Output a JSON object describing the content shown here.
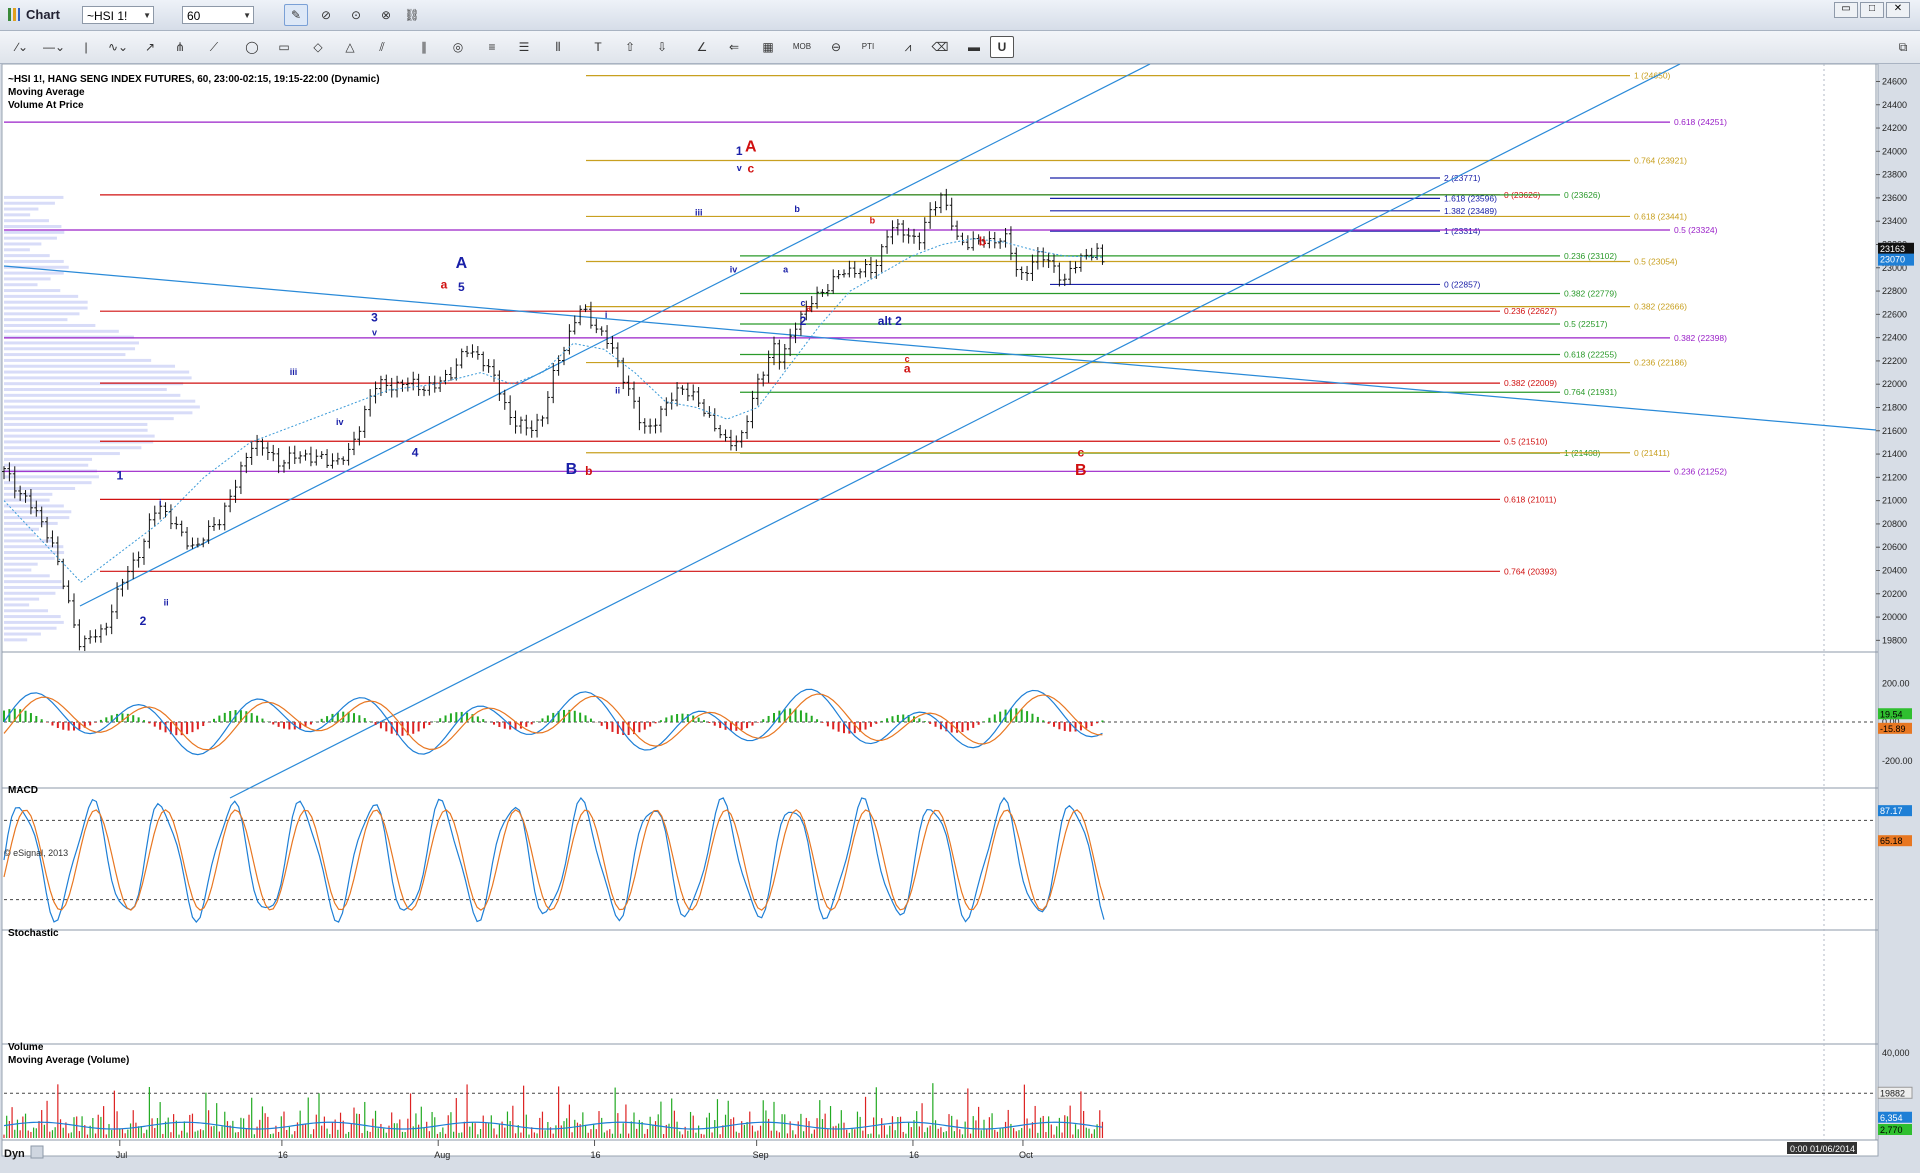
{
  "app": {
    "title": "Chart"
  },
  "toolbar": {
    "symbol": "~HSI 1!",
    "interval": "60"
  },
  "window_buttons": [
    "▭",
    "□",
    "✕"
  ],
  "icons": [
    "pencil-icon",
    "cursor-icon",
    "play-icon",
    "link-icon",
    "line-tool-icon",
    "horizontal-line-icon",
    "vertical-line-icon",
    "zigzag-icon",
    "arrow-icon",
    "fork-icon",
    "ellipse-icon",
    "rectangle-icon",
    "triangle-icon",
    "channel-icon",
    "fibonacci-icon",
    "text-icon",
    "up-arrow-icon",
    "down-arrow-icon",
    "gann-icon",
    "table-icon",
    "mob-icon",
    "pti-icon",
    "lock-icon"
  ],
  "toolbar_labels": {
    "mob": "MOB",
    "pti": "PTI"
  },
  "header": {
    "line1": "~HSI 1!, HANG SENG INDEX FUTURES, 60, 23:00-02:15, 19:15-22:00 (Dynamic)",
    "line2": "Moving Average",
    "line3": "Volume At Price"
  },
  "watermark": "© eSignal, 2013",
  "status": {
    "left": "Dyn",
    "right": "0:00 01/06/2014"
  },
  "colors": {
    "up_bar": "#22aa22",
    "down_bar": "#dd2222",
    "macd_fast": "#1e7fd6",
    "macd_slow": "#e87722",
    "channel": "#2a8ad8",
    "red": "#d01010",
    "gold": "#c8a020",
    "green": "#2a9a2a",
    "purple": "#9a20c8",
    "navy": "#1a20a8"
  },
  "chart_data": [
    {
      "type": "line",
      "title": "~HSI 1!, HANG SENG INDEX FUTURES, 60",
      "x_ticks": [
        "Jul",
        "16",
        "Aug",
        "16",
        "Sep",
        "16",
        "Oct"
      ],
      "ylim": [
        19700,
        24750
      ],
      "y_ticks": [
        19800,
        20000,
        20200,
        20400,
        20600,
        20800,
        21000,
        21200,
        21400,
        21600,
        21800,
        22000,
        22200,
        22400,
        22600,
        22800,
        23000,
        23200,
        23400,
        23600,
        23800,
        24000,
        24200,
        24400,
        24600
      ],
      "price_path": [
        [
          0,
          21250
        ],
        [
          3,
          21000
        ],
        [
          6,
          20700
        ],
        [
          8,
          20200
        ],
        [
          10,
          19750
        ],
        [
          13,
          19900
        ],
        [
          16,
          20400
        ],
        [
          18,
          20600
        ],
        [
          20,
          21000
        ],
        [
          23,
          20700
        ],
        [
          25,
          20600
        ],
        [
          28,
          20850
        ],
        [
          30,
          21100
        ],
        [
          32,
          21500
        ],
        [
          34,
          21430
        ],
        [
          36,
          21330
        ],
        [
          39,
          21400
        ],
        [
          42,
          21330
        ],
        [
          45,
          21400
        ],
        [
          47,
          21800
        ],
        [
          48,
          21970
        ],
        [
          50,
          22000
        ],
        [
          53,
          22000
        ],
        [
          56,
          21970
        ],
        [
          58,
          22100
        ],
        [
          60,
          22280
        ],
        [
          62,
          22250
        ],
        [
          64,
          22000
        ],
        [
          66,
          21700
        ],
        [
          68,
          21600
        ],
        [
          70,
          21730
        ],
        [
          72,
          22200
        ],
        [
          74,
          22520
        ],
        [
          75,
          22640
        ],
        [
          77,
          22500
        ],
        [
          79,
          22300
        ],
        [
          81,
          22000
        ],
        [
          83,
          21600
        ],
        [
          84,
          21650
        ],
        [
          86,
          21800
        ],
        [
          88,
          22000
        ],
        [
          90,
          21850
        ],
        [
          92,
          21700
        ],
        [
          94,
          21460
        ],
        [
          96,
          21580
        ],
        [
          98,
          22000
        ],
        [
          100,
          22350
        ],
        [
          101,
          22170
        ],
        [
          103,
          22550
        ],
        [
          105,
          22700
        ],
        [
          107,
          22850
        ],
        [
          109,
          22950
        ],
        [
          111,
          23000
        ],
        [
          113,
          22950
        ],
        [
          115,
          23350
        ],
        [
          117,
          23300
        ],
        [
          119,
          23250
        ],
        [
          121,
          23550
        ],
        [
          122,
          23650
        ],
        [
          123,
          23420
        ],
        [
          124,
          23200
        ],
        [
          126,
          23240
        ],
        [
          128,
          23200
        ],
        [
          130,
          23300
        ],
        [
          132,
          22900
        ],
        [
          134,
          23100
        ],
        [
          136,
          23050
        ],
        [
          138,
          22880
        ],
        [
          140,
          23100
        ],
        [
          142,
          23140
        ],
        [
          143,
          22990
        ]
      ],
      "moving_average_path": [
        [
          0,
          21000
        ],
        [
          10,
          20300
        ],
        [
          14,
          20500
        ],
        [
          20,
          20800
        ],
        [
          26,
          21200
        ],
        [
          32,
          21500
        ],
        [
          38,
          21650
        ],
        [
          44,
          21800
        ],
        [
          50,
          21950
        ],
        [
          56,
          22000
        ],
        [
          62,
          22100
        ],
        [
          66,
          22000
        ],
        [
          70,
          22100
        ],
        [
          74,
          22350
        ],
        [
          78,
          22300
        ],
        [
          82,
          22100
        ],
        [
          86,
          21850
        ],
        [
          90,
          21800
        ],
        [
          94,
          21700
        ],
        [
          98,
          21800
        ],
        [
          102,
          22150
        ],
        [
          106,
          22500
        ],
        [
          110,
          22800
        ],
        [
          114,
          22950
        ],
        [
          118,
          23100
        ],
        [
          122,
          23200
        ],
        [
          126,
          23250
        ],
        [
          130,
          23220
        ],
        [
          134,
          23150
        ],
        [
          138,
          23100
        ],
        [
          143,
          23090
        ]
      ],
      "last_price": "23163",
      "ma_value": "23070",
      "horizontal_levels": [
        {
          "label": "1 (24650)",
          "value": 24650,
          "color": "gold"
        },
        {
          "label": "0.618 (24251)",
          "value": 24251,
          "color": "purple"
        },
        {
          "label": "0.764 (23921)",
          "value": 23921,
          "color": "gold"
        },
        {
          "label": "2 (23771)",
          "value": 23771,
          "color": "navy"
        },
        {
          "label": "0 (23626)",
          "value": 23626,
          "color": "red"
        },
        {
          "label": "1.618 (23596)",
          "value": 23596,
          "color": "navy"
        },
        {
          "label": "0 (23626)",
          "value": 23626,
          "color": "green"
        },
        {
          "label": "1.382 (23489)",
          "value": 23489,
          "color": "navy"
        },
        {
          "label": "0.618 (23441)",
          "value": 23441,
          "color": "gold"
        },
        {
          "label": "1 (23314)",
          "value": 23314,
          "color": "navy"
        },
        {
          "label": "0.5 (23324)",
          "value": 23324,
          "color": "purple"
        },
        {
          "label": "0.236 (23102)",
          "value": 23102,
          "color": "green"
        },
        {
          "label": "0.5 (23054)",
          "value": 23054,
          "color": "gold"
        },
        {
          "label": "0 (22857)",
          "value": 22857,
          "color": "navy"
        },
        {
          "label": "0.382 (22779)",
          "value": 22779,
          "color": "green"
        },
        {
          "label": "0.382 (22666)",
          "value": 22666,
          "color": "gold"
        },
        {
          "label": "0.236 (22627)",
          "value": 22627,
          "color": "red"
        },
        {
          "label": "0.5 (22517)",
          "value": 22517,
          "color": "green"
        },
        {
          "label": "0.382 (22398)",
          "value": 22398,
          "color": "purple"
        },
        {
          "label": "0.618 (22255)",
          "value": 22255,
          "color": "green"
        },
        {
          "label": "0.236 (22186)",
          "value": 22186,
          "color": "gold"
        },
        {
          "label": "0.382 (22009)",
          "value": 22009,
          "color": "red"
        },
        {
          "label": "0.764 (21931)",
          "value": 21931,
          "color": "green"
        },
        {
          "label": "0.5 (21510)",
          "value": 21510,
          "color": "red"
        },
        {
          "label": "1 (21408)",
          "value": 21408,
          "color": "green"
        },
        {
          "label": "0 (21411)",
          "value": 21411,
          "color": "gold"
        },
        {
          "label": "0.236 (21252)",
          "value": 21252,
          "color": "purple"
        },
        {
          "label": "0.618 (21011)",
          "value": 21011,
          "color": "red"
        },
        {
          "label": "0.764 (20393)",
          "value": 20393,
          "color": "red"
        }
      ],
      "wave_labels": [
        {
          "text": "1",
          "x": 20,
          "y": 21180,
          "color": "navy",
          "size": "m"
        },
        {
          "text": "i",
          "x": 27,
          "y": 20960,
          "color": "navy",
          "size": "s"
        },
        {
          "text": "2",
          "x": 24,
          "y": 19930,
          "color": "navy",
          "size": "m"
        },
        {
          "text": "ii",
          "x": 28,
          "y": 20100,
          "color": "navy",
          "size": "s"
        },
        {
          "text": "iii",
          "x": 50,
          "y": 22080,
          "color": "navy",
          "size": "s"
        },
        {
          "text": "iv",
          "x": 58,
          "y": 21650,
          "color": "navy",
          "size": "s"
        },
        {
          "text": "3",
          "x": 64,
          "y": 22540,
          "color": "navy",
          "size": "m"
        },
        {
          "text": "v",
          "x": 64,
          "y": 22420,
          "color": "navy",
          "size": "s"
        },
        {
          "text": "4",
          "x": 71,
          "y": 21380,
          "color": "navy",
          "size": "m"
        },
        {
          "text": "a",
          "x": 76,
          "y": 22820,
          "color": "red",
          "size": "m"
        },
        {
          "text": "A",
          "x": 79,
          "y": 23000,
          "color": "navy",
          "size": "l"
        },
        {
          "text": "5",
          "x": 79,
          "y": 22800,
          "color": "navy",
          "size": "m"
        },
        {
          "text": "B",
          "x": 98,
          "y": 21230,
          "color": "navy",
          "size": "l"
        },
        {
          "text": "b",
          "x": 101,
          "y": 21220,
          "color": "red",
          "size": "m"
        },
        {
          "text": "i",
          "x": 104,
          "y": 22570,
          "color": "navy",
          "size": "s"
        },
        {
          "text": "ii",
          "x": 106,
          "y": 21920,
          "color": "navy",
          "size": "s"
        },
        {
          "text": "iii",
          "x": 120,
          "y": 23450,
          "color": "navy",
          "size": "s"
        },
        {
          "text": "iv",
          "x": 126,
          "y": 22960,
          "color": "navy",
          "size": "s"
        },
        {
          "text": "1",
          "x": 127,
          "y": 23970,
          "color": "navy",
          "size": "m"
        },
        {
          "text": "A",
          "x": 129,
          "y": 24000,
          "color": "red",
          "size": "l"
        },
        {
          "text": "v",
          "x": 127,
          "y": 23830,
          "color": "navy",
          "size": "s"
        },
        {
          "text": "c",
          "x": 129,
          "y": 23820,
          "color": "red",
          "size": "m"
        },
        {
          "text": "a",
          "x": 135,
          "y": 22960,
          "color": "navy",
          "size": "s"
        },
        {
          "text": "b",
          "x": 137,
          "y": 23480,
          "color": "navy",
          "size": "s"
        },
        {
          "text": "c",
          "x": 138,
          "y": 22670,
          "color": "navy",
          "size": "s"
        },
        {
          "text": "a",
          "x": 139,
          "y": 22630,
          "color": "red",
          "size": "s"
        },
        {
          "text": "2",
          "x": 138,
          "y": 22510,
          "color": "navy",
          "size": "m"
        },
        {
          "text": "b",
          "x": 150,
          "y": 23380,
          "color": "red",
          "size": "s"
        },
        {
          "text": "alt 2",
          "x": 153,
          "y": 22510,
          "color": "navy",
          "size": "m"
        },
        {
          "text": "b",
          "x": 169,
          "y": 23190,
          "color": "red",
          "size": "m"
        },
        {
          "text": "c",
          "x": 156,
          "y": 22190,
          "color": "red",
          "size": "s"
        },
        {
          "text": "a",
          "x": 156,
          "y": 22100,
          "color": "red",
          "size": "m"
        },
        {
          "text": "c",
          "x": 186,
          "y": 21380,
          "color": "red",
          "size": "m"
        },
        {
          "text": "B",
          "x": 186,
          "y": 21220,
          "color": "red",
          "size": "l"
        }
      ]
    },
    {
      "type": "line",
      "title": "MACD",
      "ylim": [
        -320,
        320
      ],
      "y_ticks": [
        "200.00",
        "0.00",
        "-200.00"
      ],
      "macd_value": "19.54",
      "signal_value": "-15.89"
    },
    {
      "type": "line",
      "title": "Stochastic",
      "ylim": [
        0,
        100
      ],
      "k_value": "87.17",
      "d_value": "65.18"
    },
    {
      "type": "bar",
      "title": "Volume",
      "subtitle": "Moving Average (Volume)",
      "ylim": [
        0,
        40000
      ],
      "y_ticks": [
        "40,000",
        "19882"
      ],
      "volume_value": "6,354",
      "ma_value": "2,770"
    }
  ]
}
